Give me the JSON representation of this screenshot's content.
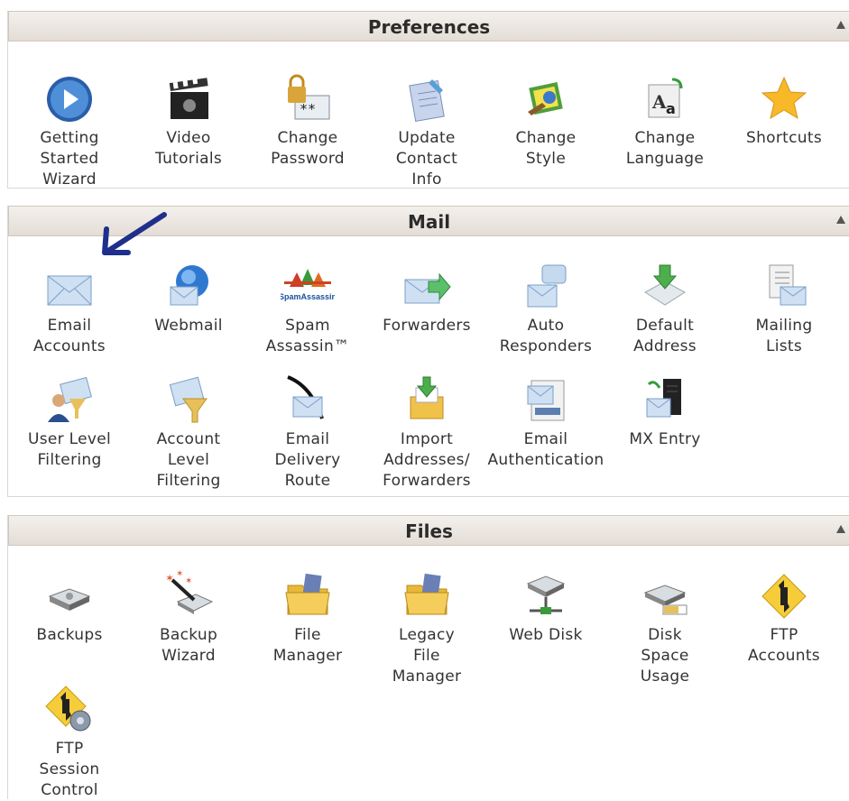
{
  "panels": {
    "preferences": {
      "title": "Preferences",
      "items": [
        {
          "label": "Getting\nStarted\nWizard",
          "icon": "play-button-icon"
        },
        {
          "label": "Video\nTutorials",
          "icon": "clapperboard-icon"
        },
        {
          "label": "Change\nPassword",
          "icon": "padlock-password-icon"
        },
        {
          "label": "Update\nContact\nInfo",
          "icon": "contact-notepad-icon"
        },
        {
          "label": "Change\nStyle",
          "icon": "style-palette-icon"
        },
        {
          "label": "Change\nLanguage",
          "icon": "language-icon"
        },
        {
          "label": "Shortcuts",
          "icon": "star-icon"
        }
      ]
    },
    "mail": {
      "title": "Mail",
      "items": [
        {
          "label": "Email\nAccounts",
          "icon": "envelope-icon"
        },
        {
          "label": "Webmail",
          "icon": "globe-envelope-icon"
        },
        {
          "label": "Spam\nAssassin™",
          "icon": "spamassassin-icon",
          "icon_text": "SpamAssassin"
        },
        {
          "label": "Forwarders",
          "icon": "forward-envelope-icon"
        },
        {
          "label": "Auto\nResponders",
          "icon": "speech-envelope-icon"
        },
        {
          "label": "Default\nAddress",
          "icon": "inbox-down-arrow-icon"
        },
        {
          "label": "Mailing\nLists",
          "icon": "list-envelope-icon"
        },
        {
          "label": "User Level\nFiltering",
          "icon": "user-filter-icon"
        },
        {
          "label": "Account\nLevel\nFiltering",
          "icon": "envelope-funnel-icon"
        },
        {
          "label": "Email\nDelivery\nRoute",
          "icon": "delivery-route-icon"
        },
        {
          "label": "Import\nAddresses/\nForwarders",
          "icon": "import-box-icon"
        },
        {
          "label": "Email\nAuthentication",
          "icon": "authentication-envelope-icon"
        },
        {
          "label": "MX Entry",
          "icon": "server-envelope-icon"
        }
      ]
    },
    "files": {
      "title": "Files",
      "items": [
        {
          "label": "Backups",
          "icon": "hard-disk-icon"
        },
        {
          "label": "Backup\nWizard",
          "icon": "disk-wand-icon"
        },
        {
          "label": "File\nManager",
          "icon": "folder-icon"
        },
        {
          "label": "Legacy\nFile\nManager",
          "icon": "legacy-folder-icon"
        },
        {
          "label": "Web Disk",
          "icon": "network-disk-icon"
        },
        {
          "label": "Disk\nSpace\nUsage",
          "icon": "disk-usage-icon"
        },
        {
          "label": "FTP\nAccounts",
          "icon": "ftp-transfer-icon"
        },
        {
          "label": "FTP\nSession\nControl",
          "icon": "ftp-gear-icon"
        }
      ]
    }
  },
  "colors": {
    "header_bg": "#e6dfd8",
    "text": "#333333",
    "annotation_arrow": "#1f2f8c"
  }
}
